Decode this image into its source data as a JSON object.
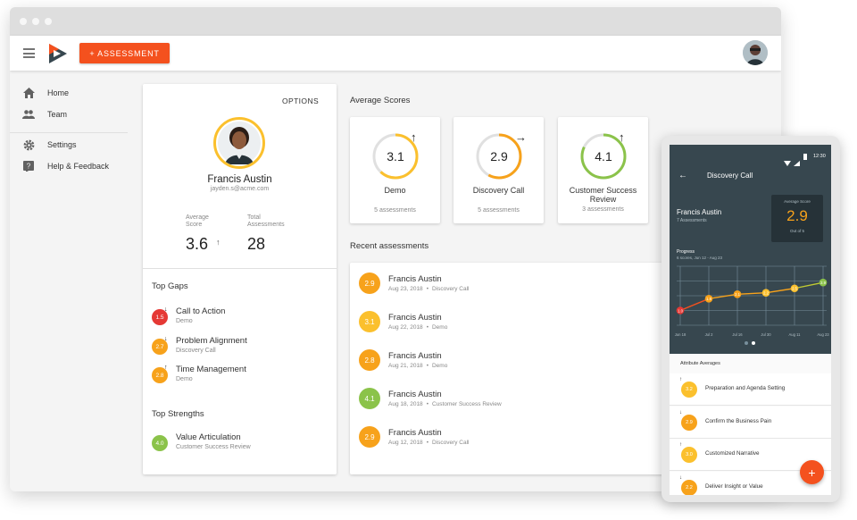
{
  "colors": {
    "accent": "#f4511e",
    "red": "#e53935",
    "orange": "#f7a21b",
    "yellow": "#fbc02d",
    "green": "#8bc34a",
    "phone_dark": "#37474f"
  },
  "header": {
    "assessment_button": "+ ASSESSMENT"
  },
  "sidebar": {
    "items": [
      {
        "label": "Home",
        "icon": "home-icon"
      },
      {
        "label": "Team",
        "icon": "people-icon"
      },
      {
        "label": "Settings",
        "icon": "gear-icon"
      },
      {
        "label": "Help & Feedback",
        "icon": "help-icon"
      }
    ]
  },
  "profile": {
    "options_label": "OPTIONS",
    "name": "Francis Austin",
    "email": "jayden.s@acme.com",
    "avg_score_label": "Average\nScore",
    "avg_score_value": "3.6",
    "avg_score_arrow": "↑",
    "total_label": "Total\nAssessments",
    "total_value": "28",
    "top_gaps_title": "Top Gaps",
    "top_gaps": [
      {
        "score": "1.5",
        "arrow": "↓",
        "title": "Call to Action",
        "sub": "Demo",
        "color": "#e53935"
      },
      {
        "score": "2.7",
        "arrow": "↓",
        "title": "Problem Alignment",
        "sub": "Discovery Call",
        "color": "#f7a21b"
      },
      {
        "score": "2.8",
        "arrow": "↑",
        "title": "Time Management",
        "sub": "Demo",
        "color": "#f7a21b"
      }
    ],
    "top_strengths_title": "Top Strengths",
    "top_strengths": [
      {
        "score": "4.0",
        "title": "Value Articulation",
        "sub": "Customer Success Review",
        "color": "#8bc34a"
      }
    ]
  },
  "avg_scores": {
    "title": "Average Scores",
    "cards": [
      {
        "score": "3.1",
        "name": "Demo",
        "count": "5 assessments",
        "arrow": "↑",
        "color": "#fbc02d",
        "fill": 0.62
      },
      {
        "score": "2.9",
        "name": "Discovery Call",
        "count": "5 assessments",
        "arrow": "→",
        "color": "#f7a21b",
        "fill": 0.58
      },
      {
        "score": "4.1",
        "name": "Customer Success Review",
        "count": "3 assessments",
        "arrow": "↑",
        "color": "#8bc34a",
        "fill": 0.82
      }
    ]
  },
  "recent": {
    "title": "Recent assessments",
    "rows": [
      {
        "score": "2.9",
        "name": "Francis Austin",
        "date": "Aug 23, 2018",
        "type": "Discovery Call",
        "color": "#f7a21b"
      },
      {
        "score": "3.1",
        "name": "Francis Austin",
        "date": "Aug 22, 2018",
        "type": "Demo",
        "color": "#fbc02d"
      },
      {
        "score": "2.8",
        "name": "Francis Austin",
        "date": "Aug 21, 2018",
        "type": "Demo",
        "color": "#f7a21b"
      },
      {
        "score": "4.1",
        "name": "Francis Austin",
        "date": "Aug 18, 2018",
        "type": "Customer Success Review",
        "color": "#8bc34a"
      },
      {
        "score": "2.9",
        "name": "Francis Austin",
        "date": "Aug 12, 2018",
        "type": "Discovery Call",
        "color": "#f7a21b"
      }
    ],
    "separator": "•"
  },
  "phone": {
    "time": "12:30",
    "title": "Discovery Call",
    "person": "Francis Austin",
    "person_sub": "7 Assessments",
    "avg_label": "Average Score",
    "avg_value": "2.9",
    "avg_out_of": "Out of 5",
    "progress_title": "Progress",
    "progress_sub": "6 scores, Jun 12 - Aug 23",
    "attr_title": "Attribute Averages",
    "attributes": [
      {
        "score": "3.2",
        "arrow": "↑",
        "label": "Preparation and Agenda Setting",
        "color": "#fbc02d"
      },
      {
        "score": "2.9",
        "arrow": "↓",
        "label": "Confirm the Business Pain",
        "color": "#f7a21b"
      },
      {
        "score": "3.0",
        "arrow": "↑",
        "label": "Customized Narrative",
        "color": "#fbc02d"
      },
      {
        "score": "2.2",
        "arrow": "↓",
        "label": "Deliver Insight or Value",
        "color": "#f7a21b"
      }
    ],
    "fab_label": "+"
  },
  "chart_data": {
    "type": "line",
    "title": "Progress",
    "subtitle": "6 scores, Jun 12 - Aug 23",
    "categories": [
      "Jun 18",
      "Jul 2",
      "Jul 16",
      "Jul 30",
      "Aug 11",
      "Aug 23"
    ],
    "x": [
      "Jun 12",
      "Jul 2",
      "Jul 18",
      "Aug 3",
      "Aug 17",
      "Aug 23"
    ],
    "values": [
      1.0,
      1.8,
      2.1,
      2.2,
      2.5,
      2.9
    ],
    "point_labels": [
      "1.0",
      "1.8",
      "2.1",
      "2.2",
      "2.5",
      "2.9"
    ],
    "ylim": [
      0,
      4
    ],
    "grid": true
  }
}
